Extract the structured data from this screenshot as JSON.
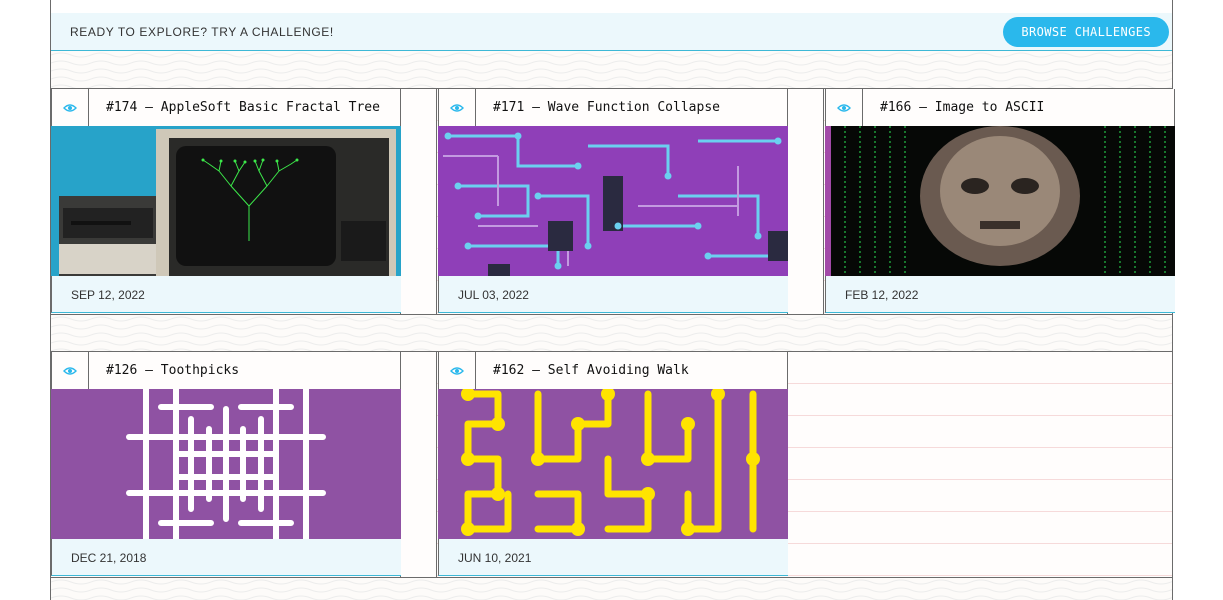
{
  "banner": {
    "text": "Ready to explore? Try a challenge!",
    "button_label": "BROWSE CHALLENGES"
  },
  "challenges": [
    {
      "title": "#174 — AppleSoft Basic Fractal Tree",
      "date": "SEP 12, 2022",
      "image_icon": "apple-ii-fractal"
    },
    {
      "title": "#171 — Wave Function Collapse",
      "date": "JUL 03, 2022",
      "image_icon": "circuit-board"
    },
    {
      "title": "#166 — Image to ASCII",
      "date": "FEB 12, 2022",
      "image_icon": "ascii-portrait"
    },
    {
      "title": "#126 — Toothpicks",
      "date": "DEC 21, 2018",
      "image_icon": "toothpicks-pattern"
    },
    {
      "title": "#162 — Self Avoiding Walk",
      "date": "JUN 10, 2021",
      "image_icon": "yellow-walk"
    }
  ],
  "colors": {
    "accent": "#2ab8ec",
    "footer_bg": "#ecf8fc",
    "purple": "#8f52a3",
    "yellow": "#ffe400"
  }
}
